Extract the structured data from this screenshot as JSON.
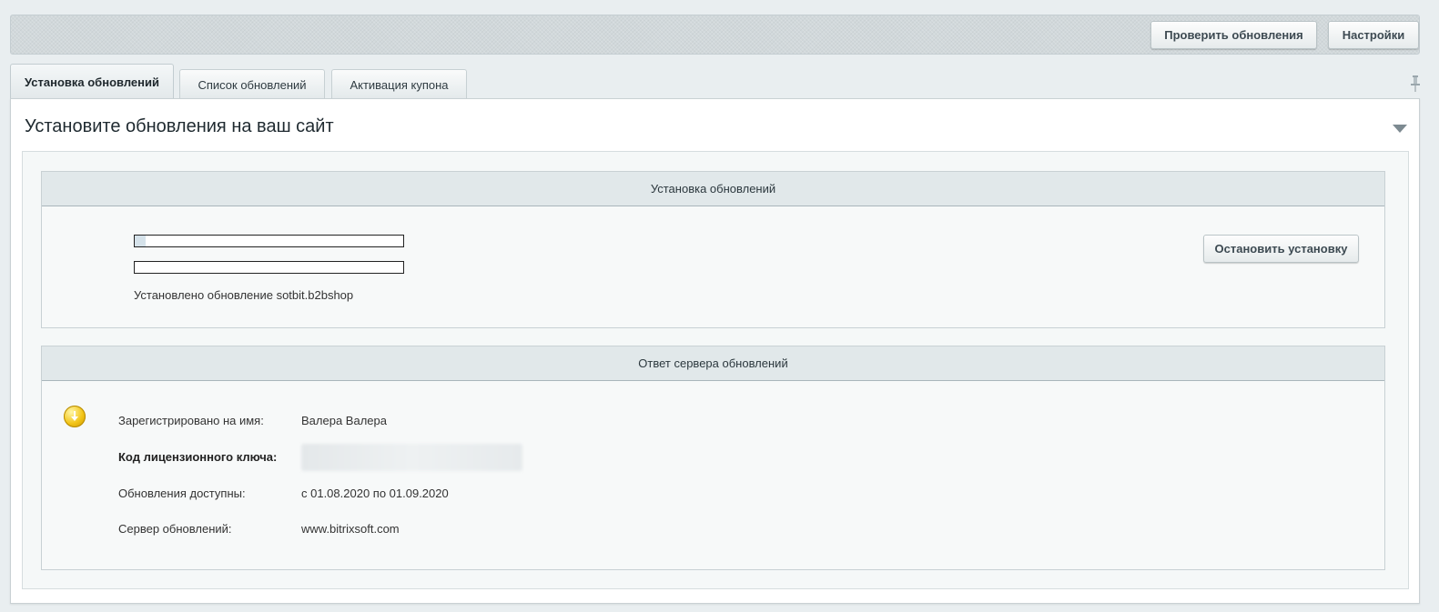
{
  "toolbar": {
    "check_updates_label": "Проверить обновления",
    "settings_label": "Настройки"
  },
  "tabs": [
    {
      "label": "Установка обновлений",
      "active": true
    },
    {
      "label": "Список обновлений",
      "active": false
    },
    {
      "label": "Активация купона",
      "active": false
    }
  ],
  "panel": {
    "title": "Установите обновления на ваш сайт"
  },
  "install_section": {
    "header": "Установка обновлений",
    "progress_1_fraction": 0.04,
    "progress_2_fraction": 0.0,
    "status_text": "Установлено обновление sotbit.b2bshop",
    "stop_button_label": "Остановить установку"
  },
  "server_section": {
    "header": "Ответ сервера обновлений",
    "rows": [
      {
        "label": "Зарегистрировано на имя:",
        "value": "Валера Валера"
      },
      {
        "label": "Код лицензионного ключа:",
        "value": ""
      },
      {
        "label": "Обновления доступны:",
        "value": "с 01.08.2020 по 01.09.2020"
      },
      {
        "label": "Сервер обновлений:",
        "value": "www.bitrixsoft.com"
      }
    ]
  },
  "icons": {
    "pin": "pin-icon",
    "collapse": "chevron-down-icon",
    "info": "download-info-icon"
  }
}
